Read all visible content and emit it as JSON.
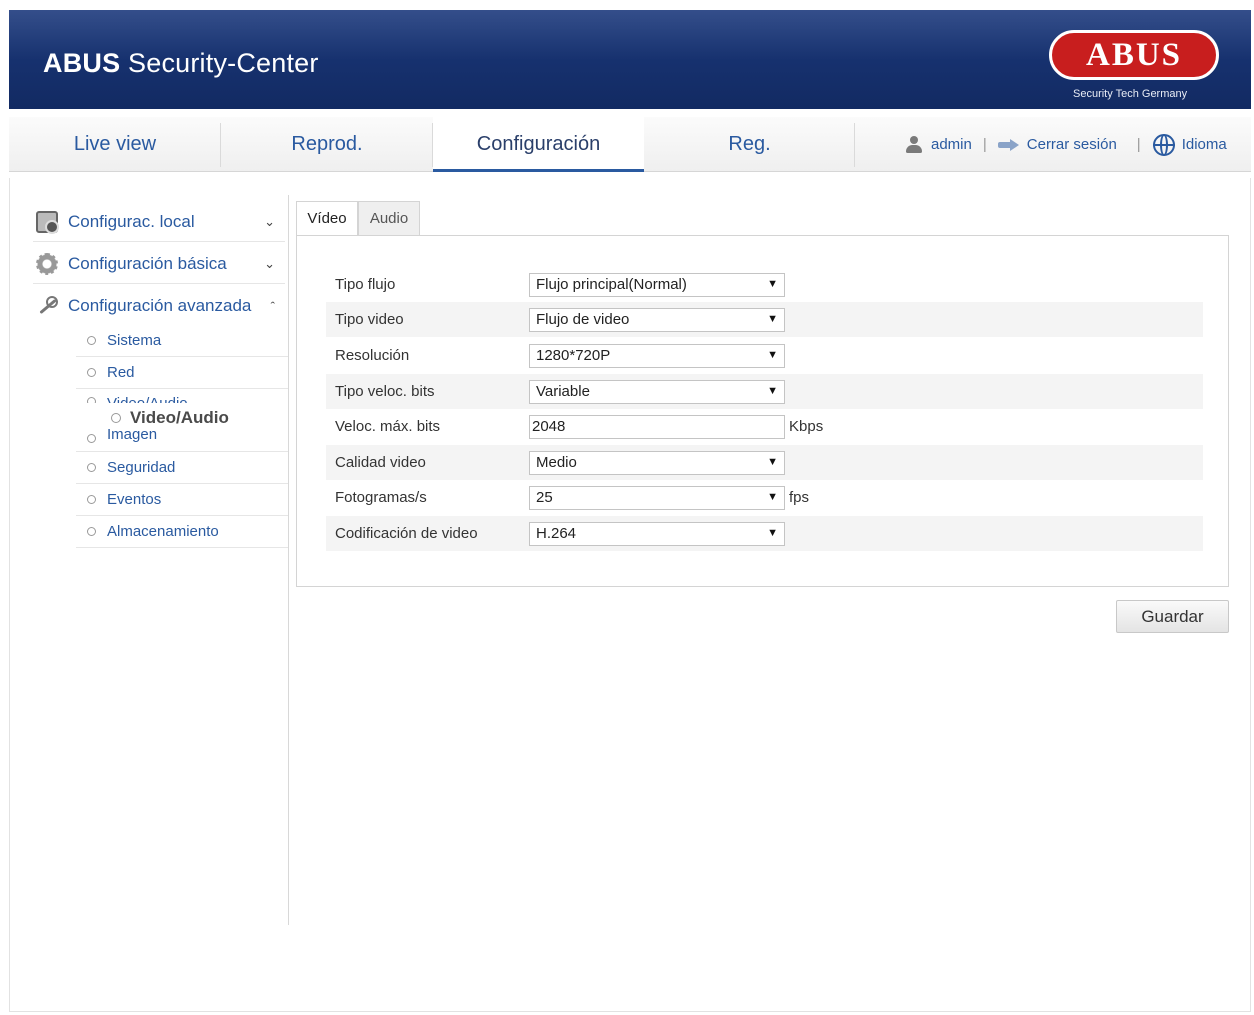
{
  "header": {
    "brand_bold": "ABUS",
    "brand_rest": " Security-Center",
    "logo_text": "ABUS",
    "logo_tagline": "Security Tech Germany"
  },
  "nav": {
    "tabs": [
      {
        "label": "Live view"
      },
      {
        "label": "Reprod."
      },
      {
        "label": "Configuración",
        "active": true
      },
      {
        "label": "Reg."
      }
    ],
    "user": "admin",
    "logout": "Cerrar sesión",
    "language": "Idioma"
  },
  "sidebar": {
    "groups": [
      {
        "label": "Configurac. local",
        "icon": "local-config-icon",
        "expanded": false
      },
      {
        "label": "Configuración básica",
        "icon": "gear-icon",
        "expanded": false
      },
      {
        "label": "Configuración avanzada",
        "icon": "wrench-icon",
        "expanded": true
      }
    ],
    "subitems": [
      {
        "label": "Sistema"
      },
      {
        "label": "Red"
      },
      {
        "label": "Video/Audio"
      },
      {
        "label": "Imagen"
      },
      {
        "label": "Seguridad"
      },
      {
        "label": "Eventos"
      },
      {
        "label": "Almacenamiento"
      }
    ],
    "drag_ghost": "Video/Audio"
  },
  "content": {
    "tabs": [
      {
        "label": "Vídeo",
        "active": true
      },
      {
        "label": "Audio"
      }
    ],
    "fields": [
      {
        "label": "Tipo flujo",
        "type": "select",
        "value": "Flujo principal(Normal)"
      },
      {
        "label": "Tipo video",
        "type": "select",
        "value": "Flujo de video"
      },
      {
        "label": "Resolución",
        "type": "select",
        "value": "1280*720P"
      },
      {
        "label": "Tipo veloc. bits",
        "type": "select",
        "value": "Variable"
      },
      {
        "label": "Veloc. máx. bits",
        "type": "input",
        "value": "2048",
        "unit": "Kbps"
      },
      {
        "label": "Calidad video",
        "type": "select",
        "value": "Medio"
      },
      {
        "label": "Fotogramas/s",
        "type": "select",
        "value": "25",
        "unit": "fps"
      },
      {
        "label": "Codificación de video",
        "type": "select",
        "value": "H.264"
      }
    ],
    "save_label": "Guardar"
  },
  "colors": {
    "header_blue": "#173270",
    "link_blue": "#2a5aa0",
    "logo_red": "#c81e1e"
  }
}
